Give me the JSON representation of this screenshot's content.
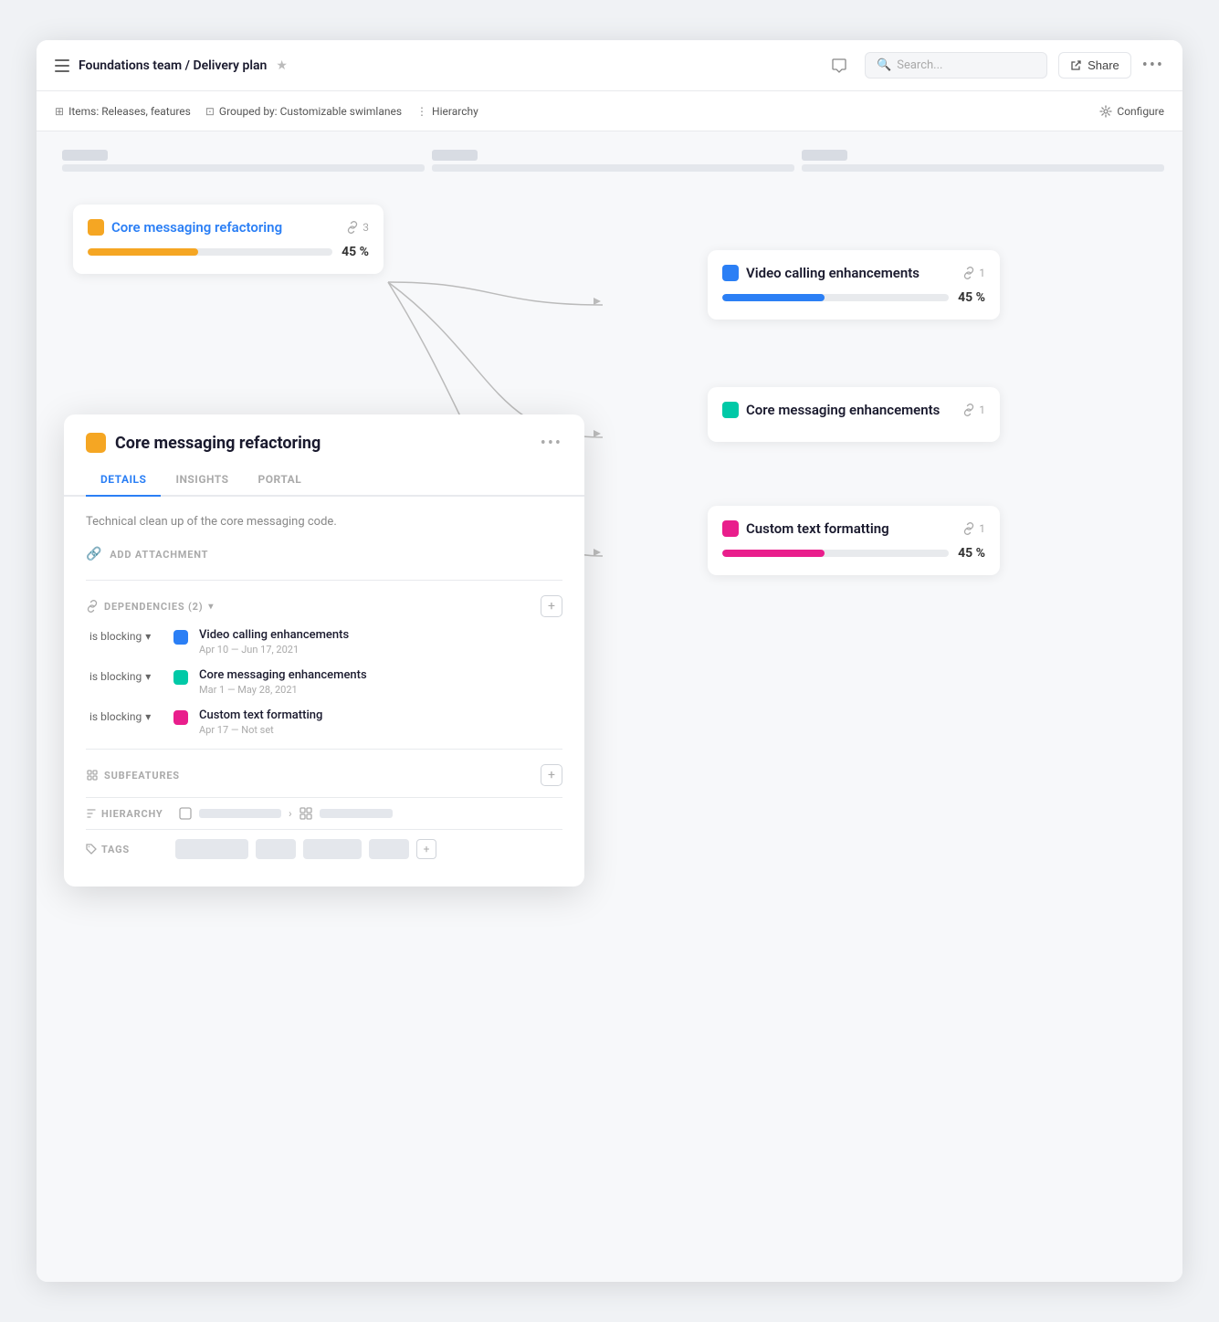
{
  "header": {
    "breadcrumb": "Foundations team / Delivery plan",
    "star_label": "★",
    "search_placeholder": "Search...",
    "share_label": "Share",
    "more_label": "•••"
  },
  "toolbar": {
    "items_label": "Items: Releases, features",
    "grouped_label": "Grouped by: Customizable swimlanes",
    "hierarchy_label": "Hierarchy",
    "configure_label": "Configure"
  },
  "background_cards": [
    {
      "title": "Core messaging refactoring",
      "color": "yellow",
      "progress": 45,
      "links": 3
    },
    {
      "title": "Video calling enhancements",
      "color": "blue",
      "progress": 45,
      "links": 1
    },
    {
      "title": "Core messaging enhancements",
      "color": "teal",
      "progress": null,
      "links": 1
    },
    {
      "title": "Custom text formatting",
      "color": "pink",
      "progress": 45,
      "links": 1
    }
  ],
  "detail_panel": {
    "title": "Core messaging refactoring",
    "tabs": [
      "DETAILS",
      "INSIGHTS",
      "PORTAL"
    ],
    "active_tab": "DETAILS",
    "description": "Technical clean up of the core messaging code.",
    "attachment_label": "ADD ATTACHMENT",
    "dependencies_label": "DEPENDENCIES (2)",
    "dependencies": [
      {
        "relation": "is blocking",
        "name": "Video calling enhancements",
        "dates": "Apr 10 — Jun 17, 2021",
        "color": "blue"
      },
      {
        "relation": "is blocking",
        "name": "Core messaging enhancements",
        "dates": "Mar 1 — May 28, 2021",
        "color": "teal"
      },
      {
        "relation": "is blocking",
        "name": "Custom text formatting",
        "dates": "Apr 17 — Not set",
        "color": "pink"
      }
    ],
    "subfeatures_label": "SUBFEATURES",
    "hierarchy_label": "HIERARCHY",
    "tags_label": "TAGS"
  }
}
